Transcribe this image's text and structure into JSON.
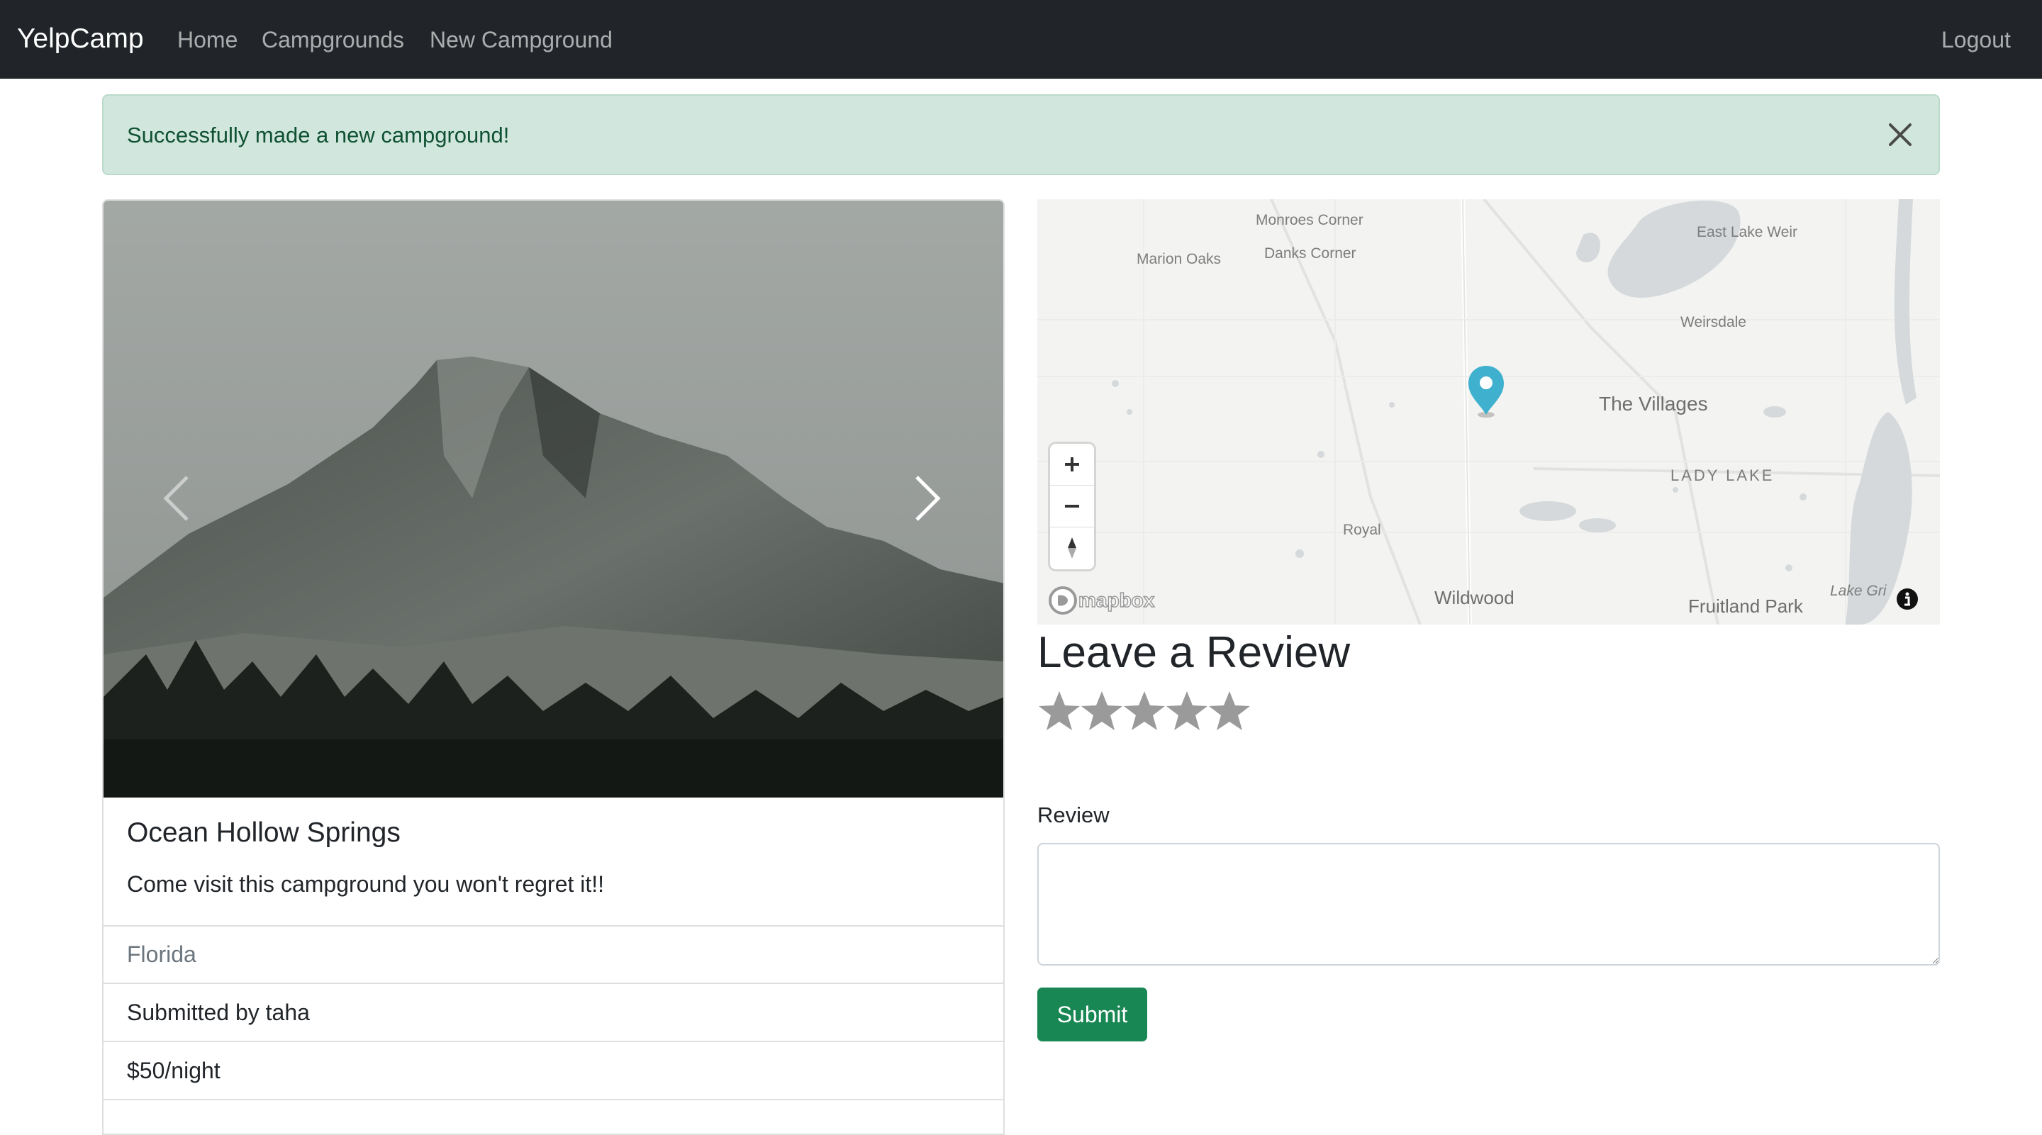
{
  "navbar": {
    "brand": "YelpCamp",
    "links": [
      "Home",
      "Campgrounds",
      "New Campground"
    ],
    "logout": "Logout"
  },
  "alert": {
    "message": "Successfully made a new campground!",
    "close_icon": "close-icon"
  },
  "campground": {
    "title": "Ocean Hollow Springs",
    "description": "Come visit this campground you won't regret it!!",
    "location": "Florida",
    "submitted_by": "Submitted by taha",
    "price": "$50/night"
  },
  "carousel": {
    "prev_icon": "chevron-left-icon",
    "next_icon": "chevron-right-icon"
  },
  "map": {
    "labels": {
      "monroes_corner": "Monroes Corner",
      "marion_oaks": "Marion Oaks",
      "danks_corner": "Danks Corner",
      "east_lake_weir": "East Lake Weir",
      "weirsdale": "Weirsdale",
      "the_villages": "The Villages",
      "lady_lake": "LADY LAKE",
      "royal": "Royal",
      "wildwood": "Wildwood",
      "fruitland_park": "Fruitland Park",
      "lake_griffin": "Lake Gri"
    },
    "zoom_in": "+",
    "zoom_out": "−",
    "attribution": "mapbox",
    "marker_color": "#3fb1ce"
  },
  "review": {
    "heading": "Leave a Review",
    "rating_stars": 5,
    "label": "Review",
    "textarea_value": "",
    "submit": "Submit"
  },
  "colors": {
    "navbar_bg": "#212529",
    "alert_bg": "#d1e7dd",
    "alert_text": "#0f5132",
    "submit_bg": "#198754",
    "star": "#9a9a9a"
  }
}
